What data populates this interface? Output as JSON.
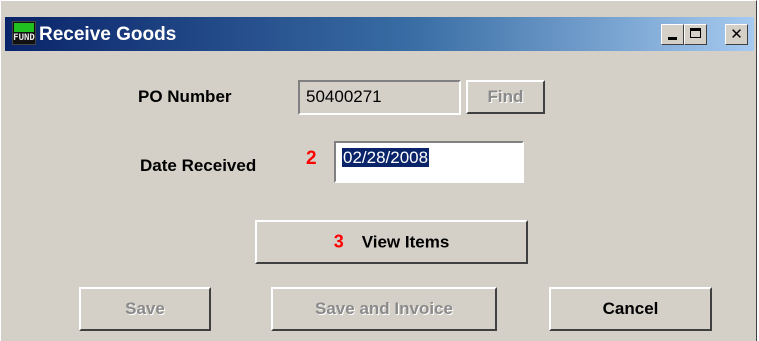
{
  "window": {
    "title": "Receive Goods",
    "icon_text": "FUND",
    "controls": {
      "minimize": "_",
      "maximize": "□",
      "close": "✕"
    }
  },
  "form": {
    "po_label": "PO Number",
    "po_value": "50400271",
    "find_label": "Find",
    "date_label": "Date Received",
    "date_marker": "2",
    "date_value": "02/28/2008",
    "view_marker": "3",
    "view_label": "View Items"
  },
  "footer": {
    "save_label": "Save",
    "save_invoice_label": "Save and Invoice",
    "cancel_label": "Cancel"
  },
  "colors": {
    "titlebar_start": "#0a246a",
    "titlebar_end": "#a6caf0",
    "marker": "#ff0000",
    "face": "#d4d0c8"
  }
}
